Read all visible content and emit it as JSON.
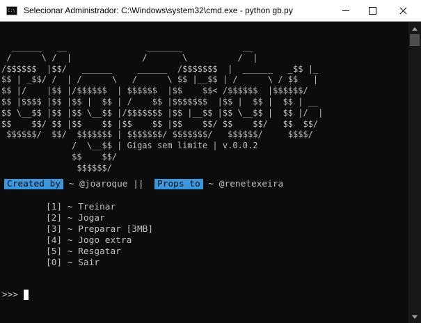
{
  "window": {
    "icon_text": "C:\\",
    "title": "Selecionar Administrador: C:\\Windows\\system32\\cmd.exe - python  gb.py"
  },
  "banner": {
    "art": "  ______   __                _______            __\n /      \\ /  |              /       \\          /  |\n/$$$$$$  |$$/   ______     ______  /$$$$$$$  |  ______   _$$ |_\n$$ | _$$/ /  | /      \\   /      \\ $$ |__$$ | /      \\ / $$   |\n$$ |/    |$$ |/$$$$$$  | $$$$$$  |$$    $$< /$$$$$$  |$$$$$$/\n$$ |$$$$ |$$ |$$ |  $$ | /    $$ |$$$$$$$  |$$ |  $$ |  $$ | __\n$$ \\__$$ |$$ |$$ \\__$$ |/$$$$$$$ |$$ |__$$ |$$ \\__$$ |  $$ |/  |\n$$    $$/ $$ |$$    $$ |$$    $$ |$$    $$/ $$    $$/   $$  $$/\n $$$$$$/  $$/  $$$$$$$ | $$$$$$$/ $$$$$$$/   $$$$$$/     $$$$/\n              /  \\__$$ | Gigas sem limite | v.0.0.2\n              $$    $$/\n               $$$$$$/"
  },
  "credits": {
    "created_label": "Created by",
    "created_user": " ~ @joaroque ||  ",
    "props_label": "Props to",
    "props_user": " ~ @renetexeira"
  },
  "menu": {
    "items": [
      "[1] ~ Treinar",
      "[2] ~ Jogar",
      "[3] ~ Preparar [3MB]",
      "[4] ~ Jogo extra",
      "[5] ~ Resgatar",
      "[0] ~ Sair"
    ]
  },
  "prompt": ">>>"
}
